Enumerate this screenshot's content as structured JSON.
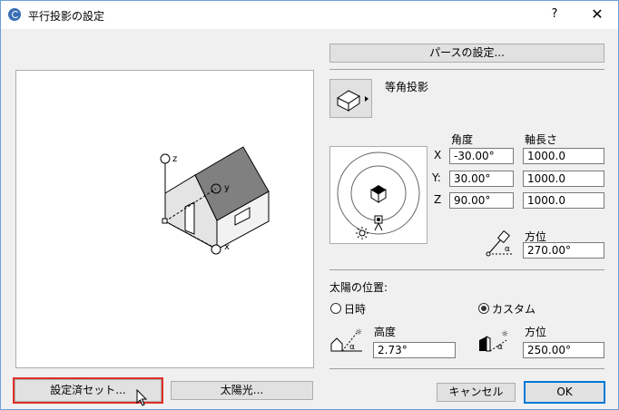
{
  "window": {
    "title": "平行投影の設定",
    "help_label": "?",
    "close_label": "✕"
  },
  "buttons": {
    "perspective_settings": "パースの設定...",
    "saved_presets": "設定済セット...",
    "sun_light": "太陽光...",
    "cancel": "キャンセル",
    "ok": "OK"
  },
  "projection": {
    "type_label": "等角投影"
  },
  "axes": {
    "angle_header": "角度",
    "length_header": "軸長さ",
    "rows": [
      {
        "axis": "X",
        "angle": "-30.00°",
        "length": "1000.0"
      },
      {
        "axis": "Y:",
        "angle": "30.00°",
        "length": "1000.0"
      },
      {
        "axis": "Z",
        "angle": "90.00°",
        "length": "1000.0"
      }
    ]
  },
  "view_direction": {
    "label": "方位",
    "value": "270.00°"
  },
  "sun_position": {
    "section_label": "太陽の位置:",
    "option_datetime": "日時",
    "option_custom": "カスタム",
    "selected": "カスタム",
    "altitude_label": "高度",
    "altitude_value": "2.73°",
    "azimuth_label": "方位",
    "azimuth_value": "250.00°"
  },
  "preview": {
    "axis_z": "z",
    "axis_y": "y",
    "axis_x": "x"
  },
  "colors": {
    "accent": "#0078d7",
    "highlight_red": "#e0302a",
    "roof_gray": "#808080"
  }
}
